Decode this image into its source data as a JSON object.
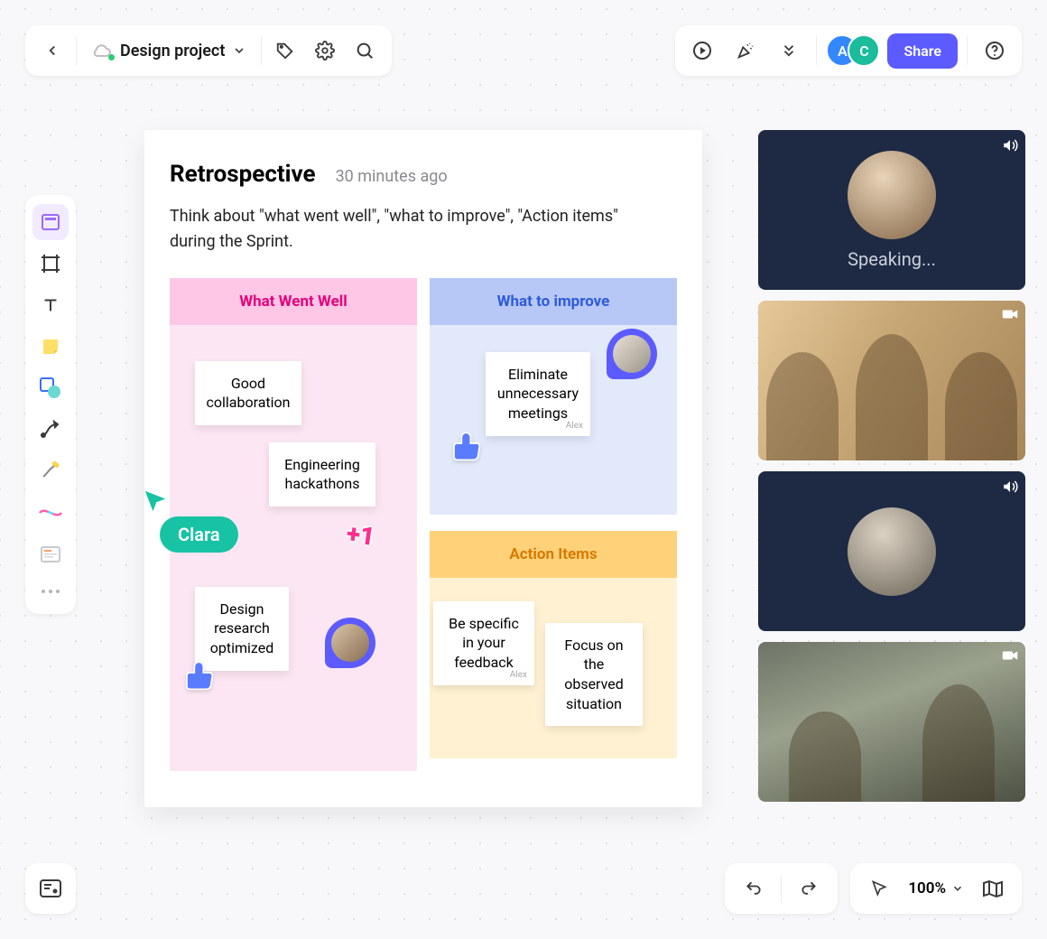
{
  "topbar": {
    "project_name": "Design project",
    "avatars": [
      {
        "initial": "A",
        "color": "#3388ff"
      },
      {
        "initial": "C",
        "color": "#1abc9c"
      }
    ],
    "share_label": "Share"
  },
  "card": {
    "title": "Retrospective",
    "time": "30 minutes ago",
    "description": "Think about \"what went well\", \"what to improve\", \"Action items\" during the Sprint.",
    "columns": {
      "well": {
        "header": "What Went Well",
        "notes": [
          {
            "text": "Good collaboration"
          },
          {
            "text": "Engineering hackathons"
          },
          {
            "text": "Design research optimized"
          }
        ]
      },
      "improve": {
        "header": "What to improve",
        "notes": [
          {
            "text": "Eliminate unnecessary meetings",
            "author": "Alex"
          }
        ]
      },
      "action": {
        "header": "Action Items",
        "notes": [
          {
            "text": "Be specific in your feedback",
            "author": "Alex"
          },
          {
            "text": "Focus on the observed situation"
          }
        ]
      }
    },
    "plus_one": "+1"
  },
  "cursor": {
    "name": "Clara"
  },
  "videos": {
    "tiles": [
      {
        "kind": "dark",
        "label": "Speaking...",
        "icon": "speaker"
      },
      {
        "kind": "photo",
        "icon": "camera"
      },
      {
        "kind": "dark",
        "label": "",
        "icon": "speaker"
      },
      {
        "kind": "photo",
        "icon": "camera"
      }
    ]
  },
  "bottom": {
    "zoom": "100%"
  }
}
